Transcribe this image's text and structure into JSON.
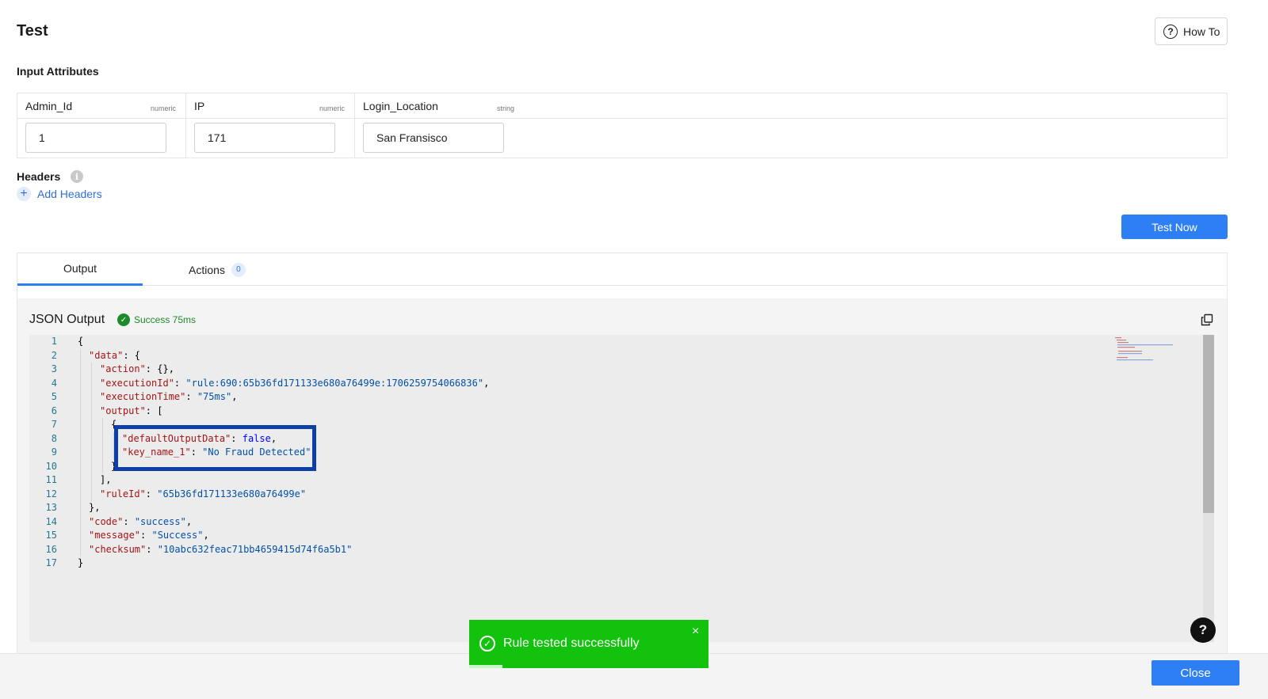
{
  "header": {
    "title": "Test",
    "how_to_label": "How To"
  },
  "input_attributes": {
    "title": "Input Attributes",
    "columns": [
      {
        "name": "Admin_Id",
        "type": "numeric",
        "value": "1"
      },
      {
        "name": "IP",
        "type": "numeric",
        "value": "171"
      },
      {
        "name": "Login_Location",
        "type": "string",
        "value": "San Fransisco"
      }
    ]
  },
  "headers": {
    "title": "Headers",
    "add_label": "Add Headers"
  },
  "test_now_label": "Test Now",
  "tabs": [
    {
      "label": "Output",
      "active": true
    },
    {
      "label": "Actions",
      "count": "0",
      "active": false
    }
  ],
  "output": {
    "title": "JSON Output",
    "status": "Success 75ms",
    "lines": [
      {
        "n": "1",
        "indent": 0,
        "tokens": [
          [
            "p",
            "{"
          ]
        ]
      },
      {
        "n": "2",
        "indent": 1,
        "tokens": [
          [
            "k",
            "\"data\""
          ],
          [
            "p",
            ": {"
          ]
        ]
      },
      {
        "n": "3",
        "indent": 2,
        "tokens": [
          [
            "k",
            "\"action\""
          ],
          [
            "p",
            ": {},"
          ]
        ]
      },
      {
        "n": "4",
        "indent": 2,
        "tokens": [
          [
            "k",
            "\"executionId\""
          ],
          [
            "p",
            ": "
          ],
          [
            "s",
            "\"rule:690:65b36fd171133e680a76499e:1706259754066836\""
          ],
          [
            "p",
            ","
          ]
        ]
      },
      {
        "n": "5",
        "indent": 2,
        "tokens": [
          [
            "k",
            "\"executionTime\""
          ],
          [
            "p",
            ": "
          ],
          [
            "s",
            "\"75ms\""
          ],
          [
            "p",
            ","
          ]
        ]
      },
      {
        "n": "6",
        "indent": 2,
        "tokens": [
          [
            "k",
            "\"output\""
          ],
          [
            "p",
            ": ["
          ]
        ]
      },
      {
        "n": "7",
        "indent": 3,
        "tokens": [
          [
            "p",
            "{"
          ]
        ]
      },
      {
        "n": "8",
        "indent": 4,
        "tokens": [
          [
            "k",
            "\"defaultOutputData\""
          ],
          [
            "p",
            ": "
          ],
          [
            "b",
            "false"
          ],
          [
            "p",
            ","
          ]
        ]
      },
      {
        "n": "9",
        "indent": 4,
        "tokens": [
          [
            "k",
            "\"key_name_1\""
          ],
          [
            "p",
            ": "
          ],
          [
            "s",
            "\"No Fraud Detected\""
          ]
        ]
      },
      {
        "n": "10",
        "indent": 3,
        "tokens": [
          [
            "p",
            "}"
          ]
        ]
      },
      {
        "n": "11",
        "indent": 2,
        "tokens": [
          [
            "p",
            "],"
          ]
        ]
      },
      {
        "n": "12",
        "indent": 2,
        "tokens": [
          [
            "k",
            "\"ruleId\""
          ],
          [
            "p",
            ": "
          ],
          [
            "s",
            "\"65b36fd171133e680a76499e\""
          ]
        ]
      },
      {
        "n": "13",
        "indent": 1,
        "tokens": [
          [
            "p",
            "},"
          ]
        ]
      },
      {
        "n": "14",
        "indent": 1,
        "tokens": [
          [
            "k",
            "\"code\""
          ],
          [
            "p",
            ": "
          ],
          [
            "s",
            "\"success\""
          ],
          [
            "p",
            ","
          ]
        ]
      },
      {
        "n": "15",
        "indent": 1,
        "tokens": [
          [
            "k",
            "\"message\""
          ],
          [
            "p",
            ": "
          ],
          [
            "s",
            "\"Success\""
          ],
          [
            "p",
            ","
          ]
        ]
      },
      {
        "n": "16",
        "indent": 1,
        "tokens": [
          [
            "k",
            "\"checksum\""
          ],
          [
            "p",
            ": "
          ],
          [
            "s",
            "\"10abc632feac71bb4659415d74f6a5b1\""
          ]
        ]
      },
      {
        "n": "17",
        "indent": 0,
        "tokens": [
          [
            "p",
            "}"
          ]
        ]
      }
    ]
  },
  "toast": {
    "message": "Rule tested successfully",
    "close_glyph": "×",
    "progress": 0.14
  },
  "help_glyph": "?",
  "footer": {
    "close_label": "Close"
  },
  "colors": {
    "primary": "#2f7ff4",
    "success": "#12c20c",
    "highlight_border": "#0d3fa8"
  }
}
